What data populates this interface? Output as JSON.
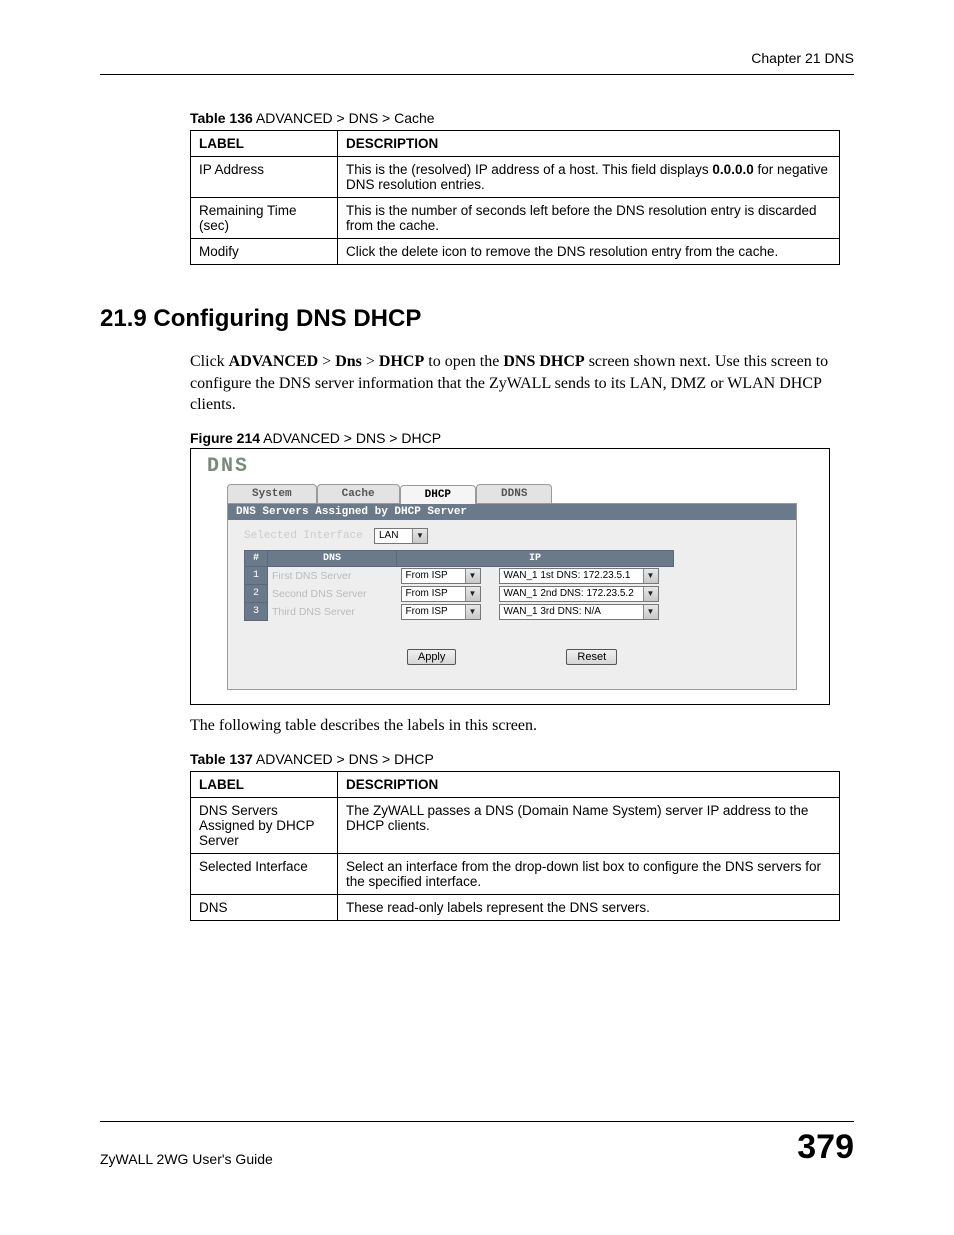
{
  "header": {
    "chapter": "Chapter 21 DNS"
  },
  "table136": {
    "caption_bold": "Table 136",
    "caption_rest": "   ADVANCED > DNS > Cache",
    "head_label": "LABEL",
    "head_desc": "DESCRIPTION",
    "rows": [
      {
        "label": "IP Address",
        "desc_before": "This is the (resolved) IP address of a host. This field displays ",
        "desc_bold": "0.0.0.0",
        "desc_after": " for negative DNS resolution entries."
      },
      {
        "label": "Remaining Time (sec)",
        "desc": "This is the number of seconds left before the DNS resolution entry is discarded from the cache."
      },
      {
        "label": "Modify",
        "desc": "Click the delete icon to remove the DNS resolution entry from the cache."
      }
    ]
  },
  "section": {
    "heading": "21.9  Configuring DNS DHCP",
    "p1_a": "Click ",
    "p1_b1": "ADVANCED",
    "p1_gt1": " > ",
    "p1_b2": "Dns",
    "p1_gt2": " > ",
    "p1_b3": "DHCP",
    "p1_c": " to open the ",
    "p1_b4": "DNS DHCP",
    "p1_d": " screen shown next. Use this screen to configure the DNS server information that the ZyWALL sends to its LAN, DMZ or WLAN DHCP clients."
  },
  "figure": {
    "caption_bold": "Figure 214",
    "caption_rest": "   ADVANCED > DNS > DHCP"
  },
  "shot": {
    "title": "DNS",
    "tabs": {
      "system": "System",
      "cache": "Cache",
      "dhcp": "DHCP",
      "ddns": "DDNS"
    },
    "sectionbar": "DNS Servers Assigned by DHCP Server",
    "selected_interface_label": "Selected Interface",
    "selected_interface_value": "LAN",
    "th_num": "#",
    "th_dns": "DNS",
    "th_ip": "IP",
    "rows": [
      {
        "n": "1",
        "name": "First DNS Server",
        "src": "From ISP",
        "ip": "WAN_1 1st DNS: 172.23.5.1"
      },
      {
        "n": "2",
        "name": "Second DNS Server",
        "src": "From ISP",
        "ip": "WAN_1 2nd DNS: 172.23.5.2"
      },
      {
        "n": "3",
        "name": "Third DNS Server",
        "src": "From ISP",
        "ip": "WAN_1 3rd DNS: N/A"
      }
    ],
    "apply": "Apply",
    "reset": "Reset"
  },
  "after_fig": "The following table describes the labels in this screen.",
  "table137": {
    "caption_bold": "Table 137",
    "caption_rest": "   ADVANCED > DNS > DHCP",
    "head_label": "LABEL",
    "head_desc": "DESCRIPTION",
    "rows": [
      {
        "label": "DNS Servers Assigned by DHCP Server",
        "desc": "The ZyWALL passes a DNS (Domain Name System) server IP address to the DHCP clients."
      },
      {
        "label": "Selected Interface",
        "desc": "Select an interface from the drop-down list box to configure the DNS servers for the specified interface."
      },
      {
        "label": "DNS",
        "desc": "These read-only labels represent the DNS servers."
      }
    ]
  },
  "footer": {
    "left": "ZyWALL 2WG User's Guide",
    "right": "379"
  }
}
